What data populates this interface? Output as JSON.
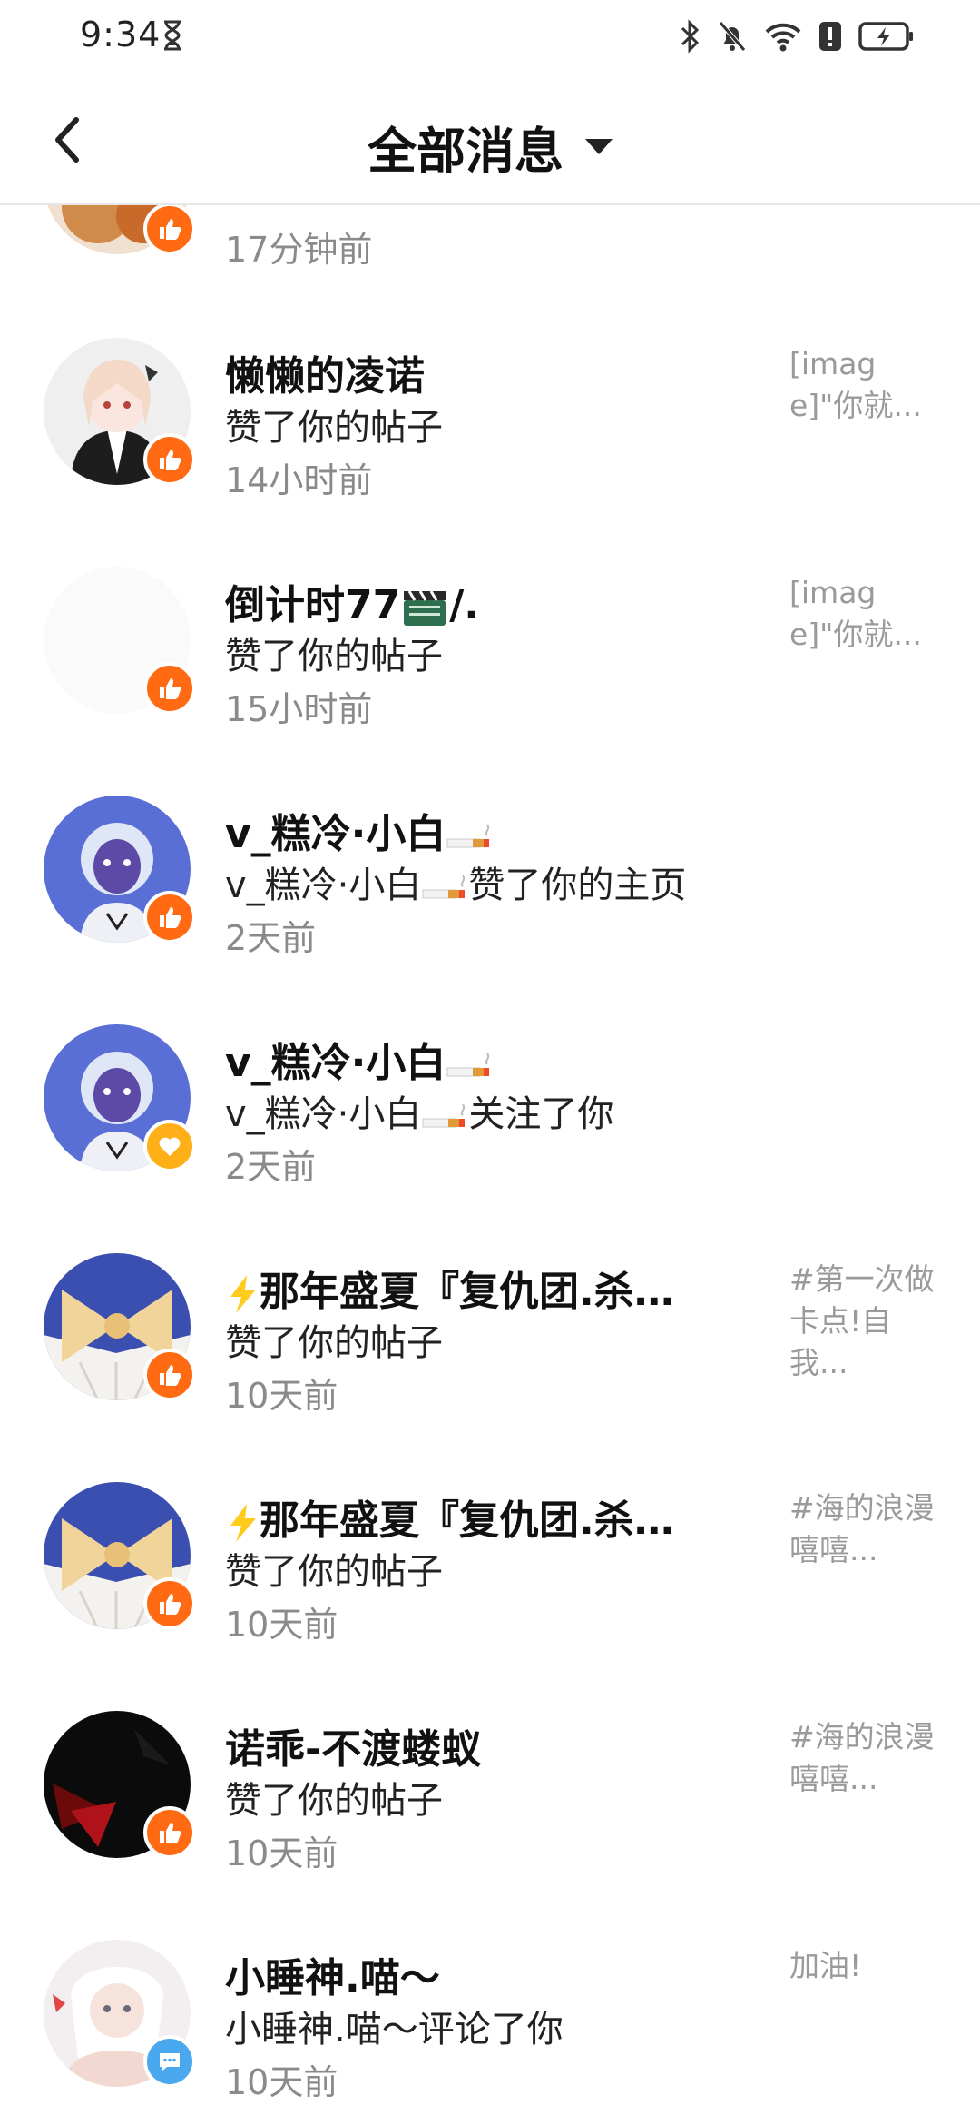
{
  "status_bar": {
    "time": "9:34"
  },
  "header": {
    "title": "全部消息"
  },
  "messages": [
    {
      "name": "",
      "action": "",
      "time": "17分钟前",
      "preview": "",
      "badge": "like"
    },
    {
      "name": "懒懒的凌诺",
      "action": "赞了你的帖子",
      "time": "14小时前",
      "preview": "[image]\"你就...",
      "badge": "like"
    },
    {
      "name_prefix": "倒计时77",
      "name_suffix": "/.",
      "action": "赞了你的帖子",
      "time": "15小时前",
      "preview": "[image]\"你就...",
      "badge": "like"
    },
    {
      "name": "v_糕冷·小白",
      "action_prefix": "v_糕冷·小白",
      "action_suffix": "赞了你的主页",
      "time": "2天前",
      "preview": "",
      "badge": "like"
    },
    {
      "name": "v_糕冷·小白",
      "action_prefix": "v_糕冷·小白",
      "action_suffix": "关注了你",
      "time": "2天前",
      "preview": "",
      "badge": "follow"
    },
    {
      "name": "那年盛夏『复仇团.杀…",
      "action": "赞了你的帖子",
      "time": "10天前",
      "preview": "#第一次做卡点!自我...",
      "badge": "like"
    },
    {
      "name": "那年盛夏『复仇团.杀…",
      "action": "赞了你的帖子",
      "time": "10天前",
      "preview": "#海的浪漫　嘻嘻...",
      "badge": "like"
    },
    {
      "name": "诺乖-不渡蝼蚁",
      "action": "赞了你的帖子",
      "time": "10天前",
      "preview": "#海的浪漫　嘻嘻...",
      "badge": "like"
    },
    {
      "name": "小睡神.喵～",
      "action": "小睡神.喵～评论了你",
      "time": "10天前",
      "preview": "加油!",
      "badge": "comment"
    }
  ]
}
